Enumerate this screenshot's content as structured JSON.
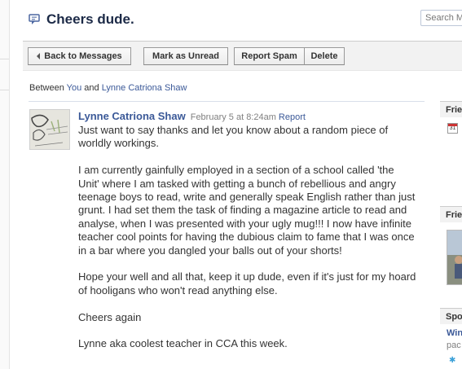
{
  "header": {
    "title": "Cheers dude.",
    "search_placeholder": "Search M"
  },
  "toolbar": {
    "back_label": "Back to Messages",
    "mark_unread_label": "Mark as Unread",
    "report_spam_label": "Report Spam",
    "delete_label": "Delete"
  },
  "thread": {
    "between_prefix": "Between",
    "participant_1": "You",
    "and_word": "and",
    "participant_2": "Lynne Catriona Shaw"
  },
  "message": {
    "author": "Lynne Catriona Shaw",
    "date": "February 5 at 8:24am",
    "report_label": "Report",
    "paragraphs": [
      "Just want to say thanks and let you know about a random piece of worldly workings.",
      "I am currently gainfully employed in a section of a school called 'the Unit' where I am tasked with getting a bunch of rebellious and angry teenage boys to read, write and generally speak English rather than just grunt. I had set them the task of finding a magazine article to read and analyse, when I was presented with your ugly mug!!! I now have infinite teacher cool points for having the dubious claim to fame that I was once in a bar where you dangled your balls out of your shorts!",
      "Hope your well and all that, keep it up dude, even if it's just for my hoard of hooligans who won't read anything else.",
      "Cheers again",
      "Lynne aka coolest teacher in CCA this week."
    ]
  },
  "sidebar": {
    "section_1_title": "Frie",
    "calendar_day": "31",
    "section_2_title": "Frie",
    "section_3_title": "Spo",
    "link_text": "Win",
    "sub_text": "pac"
  },
  "colors": {
    "link": "#3b5998",
    "title": "#1c2a47",
    "toolbar_bg": "#f2f2f2"
  }
}
